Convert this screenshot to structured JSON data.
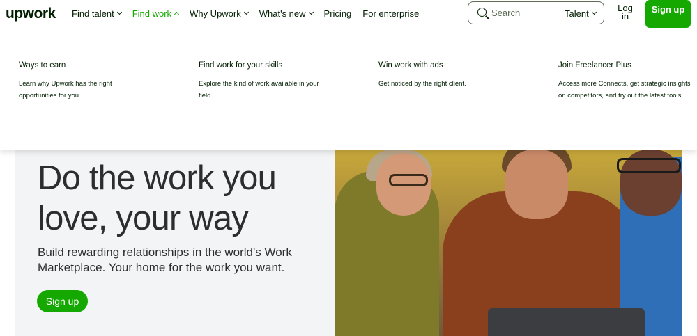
{
  "header": {
    "logo": "upwork",
    "nav": [
      {
        "label": "Find talent",
        "has_chevron": true,
        "active": false
      },
      {
        "label": "Find work",
        "has_chevron": true,
        "active": true
      },
      {
        "label": "Why Upwork",
        "has_chevron": true,
        "active": false
      },
      {
        "label": "What's new",
        "has_chevron": true,
        "active": false
      },
      {
        "label": "Pricing",
        "has_chevron": false,
        "active": false
      },
      {
        "label": "For enterprise",
        "has_chevron": false,
        "active": false
      }
    ],
    "search": {
      "placeholder": "Search",
      "scope": "Talent"
    },
    "login": "Log in",
    "signup": "Sign up",
    "accent_color": "#14a800"
  },
  "dropdown": {
    "columns": [
      {
        "title": "Ways to earn",
        "desc": "Learn why Upwork has the right opportunities for you."
      },
      {
        "title": "Find work for your skills",
        "desc": "Explore the kind of work available in your field."
      },
      {
        "title": "Win work with ads",
        "desc": "Get noticed by the right client."
      },
      {
        "title": "Join Freelancer Plus",
        "desc": "Access more Connects, get strategic insights on competitors, and try out the latest tools."
      }
    ]
  },
  "hero": {
    "title": "Do the work you love, your way",
    "subtitle": "Build rewarding relationships in the world's Work Marketplace. Your home for the work you want.",
    "cta": "Sign up"
  }
}
